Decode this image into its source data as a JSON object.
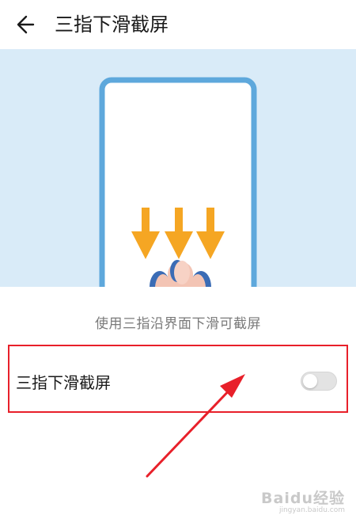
{
  "header": {
    "back_icon": "arrow-left-icon",
    "title": "三指下滑截屏"
  },
  "illustration": {
    "description": "使用三指沿界面下滑可截屏"
  },
  "setting": {
    "label": "三指下滑截屏",
    "enabled": false
  },
  "colors": {
    "illustration_bg": "#d9ebf8",
    "phone_frame": "#5ea8dc",
    "arrow": "#f5a623",
    "highlight_box": "#e8202a"
  },
  "watermark": {
    "logo": "Baidu经验",
    "url": "jingyan.baidu.com"
  }
}
